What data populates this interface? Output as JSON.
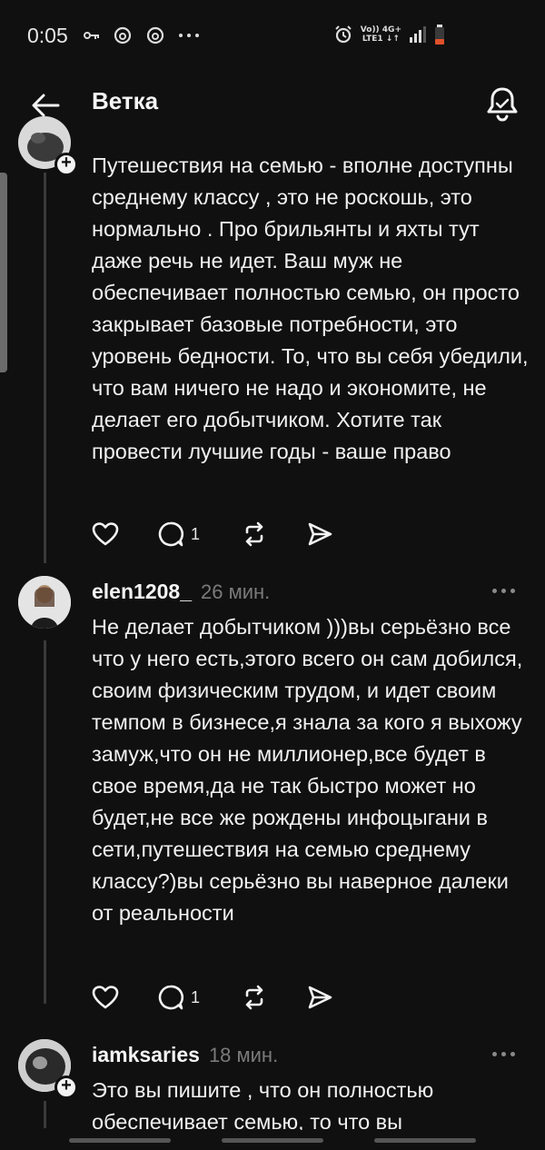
{
  "status_bar": {
    "time": "0:05",
    "network_top": "Vo)) 4G+",
    "network_bottom": "LTE1 ↓↑"
  },
  "header": {
    "title": "Ветка"
  },
  "posts": [
    {
      "text": "Путешествия на семью - вполне доступны среднему классу , это не роскошь, это нормально . Про брильянты и яхты тут даже речь не идет. Ваш муж не обеспечивает полностью семью, он просто закрывает базовые потребности, это уровень бедности. То, что вы себя убедили, что вам ничего не надо и  экономите, не делает его добытчиком. Хотите так провести лучшие годы - ваше право",
      "reply_count": "1"
    },
    {
      "username": "elen1208_",
      "timestamp": "26 мин.",
      "text": "Не делает добытчиком )))вы серьёзно все что у него есть,этого всего он сам добился, своим физическим трудом, и идет своим темпом в бизнесе,я знала за кого я выхожу замуж,что он не миллионер,все будет в свое время,да не так быстро может но будет,не все же рождены инфоцыгани в сети,путешествия на семью среднему классу?)вы серьёзно вы наверное далеки от реальности",
      "reply_count": "1"
    },
    {
      "username": "iamksaries",
      "timestamp": "18 мин.",
      "text": "Это вы пишите , что он полностью обеспечивает семью, то что вы"
    }
  ],
  "icons": {
    "back": "arrow-left-icon",
    "notifications": "bell-icon",
    "like": "heart-icon",
    "reply": "comment-bubble-icon",
    "repost": "repost-icon",
    "share": "send-icon",
    "more": "more-dots-icon",
    "follow": "plus-icon"
  },
  "colors": {
    "background": "#101010",
    "text": "#f1f1f1",
    "muted": "#7a7a7a"
  }
}
